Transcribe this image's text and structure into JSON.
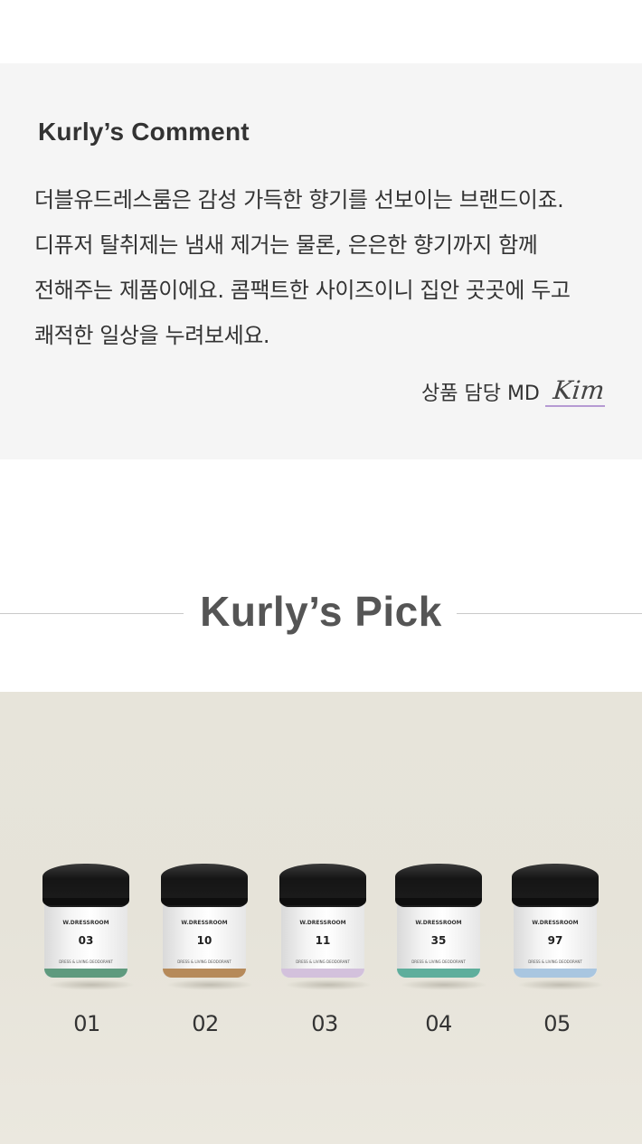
{
  "comment": {
    "title": "Kurly’s Comment",
    "body": "더블유드레스룸은 감성 가득한 향기를 선보이는 브랜드이죠. 디퓨저 탈취제는 냄새 제거는 물론, 은은한 향기까지 함께 전해주는 제품이에요. 콤팩트한 사이즈이니 집안 곳곳에 두고 쾌적한 일상을 누려보세요.",
    "signature_label": "상품 담당 MD",
    "signature_name": "Kim",
    "signature_underline_color": "#b69ad3"
  },
  "pick": {
    "title": "Kurly’s Pick"
  },
  "products": [
    {
      "label": "01",
      "brand": "W.DRESSROOM",
      "number": "03",
      "band_color": "#5f9a7e",
      "footer": "DRESS & LIVING DEODORANT"
    },
    {
      "label": "02",
      "brand": "W.DRESSROOM",
      "number": "10",
      "band_color": "#b68a5a",
      "footer": "DRESS & LIVING DEODORANT"
    },
    {
      "label": "03",
      "brand": "W.DRESSROOM",
      "number": "11",
      "band_color": "#d3c1dc",
      "footer": "DRESS & LIVING DEODORANT"
    },
    {
      "label": "04",
      "brand": "W.DRESSROOM",
      "number": "35",
      "band_color": "#5fae9c",
      "footer": "DRESS & LIVING DEODORANT"
    },
    {
      "label": "05",
      "brand": "W.DRESSROOM",
      "number": "97",
      "band_color": "#a9c6e0",
      "footer": "DRESS & LIVING DEODORANT"
    }
  ]
}
